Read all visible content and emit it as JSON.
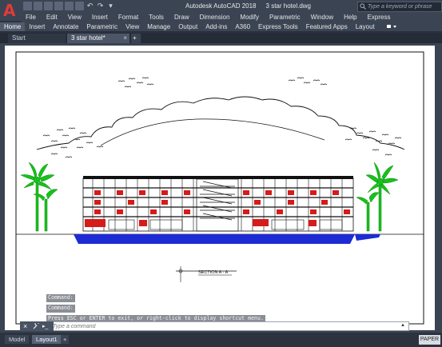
{
  "app": {
    "logo_letter": "A",
    "title": "Autodesk AutoCAD 2018",
    "document": "3 star hotel.dwg",
    "search_placeholder": "Type a keyword or phrase"
  },
  "menu": [
    "File",
    "Edit",
    "View",
    "Insert",
    "Format",
    "Tools",
    "Draw",
    "Dimension",
    "Modify",
    "Parametric",
    "Window",
    "Help",
    "Express"
  ],
  "ribbon_tabs": [
    "Home",
    "Insert",
    "Annotate",
    "Parametric",
    "View",
    "Manage",
    "Output",
    "Add-ins",
    "A360",
    "Express Tools",
    "Featured Apps",
    "Layout"
  ],
  "file_tabs": {
    "start": "Start",
    "doc": "3 star hotel*",
    "close": "×",
    "plus": "+"
  },
  "drawing": {
    "section_label": "SECTION A - A",
    "colors": {
      "sky_ground": "#1d2bd4",
      "palm": "#16c21a",
      "building_red": "#d61b1b",
      "outline": "#000000"
    }
  },
  "command": {
    "history": [
      "Command:",
      "Command:",
      "Press ESC or ENTER to exit, or right-click to display shortcut menu."
    ],
    "input_placeholder": "Type a command",
    "close_icon": "×",
    "customize_icon": "wrench"
  },
  "layout_tabs": {
    "model": "Model",
    "layout1": "Layout1",
    "plus": "+",
    "paper": "PAPER"
  }
}
